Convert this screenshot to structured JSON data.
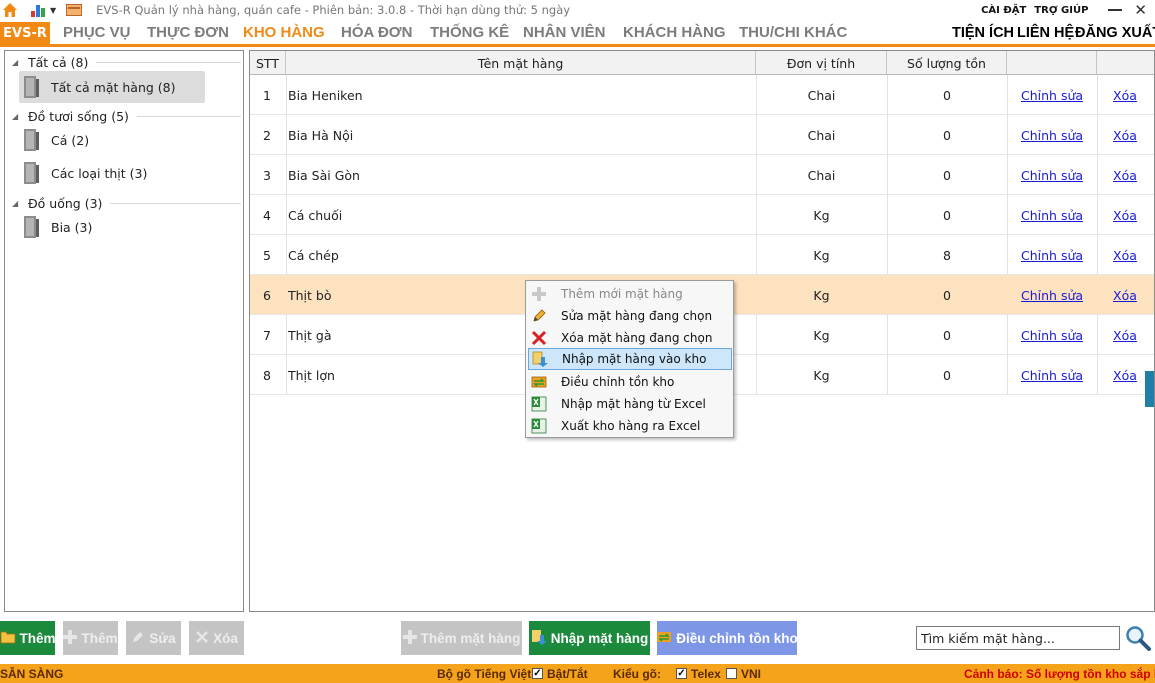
{
  "title_bar": {
    "app_title": "EVS-R Quản lý nhà hàng, quán cafe - Phiên bản: 3.0.8 - Thời hạn dùng thử: 5 ngày",
    "settings": "CÀI ĐẶT",
    "help": "TRỢ GIÚP",
    "close": "✕"
  },
  "menu": {
    "logo": "EVS-R",
    "items": [
      "PHỤC VỤ",
      "THỰC ĐƠN",
      "KHO HÀNG",
      "HÓA ĐƠN",
      "THỐNG KÊ",
      "NHÂN VIÊN",
      "KHÁCH HÀNG",
      "THU/CHI KHÁC"
    ],
    "active": "KHO HÀNG",
    "right": [
      "TIỆN ÍCH",
      "LIÊN HỆ",
      "ĐĂNG XUẤT"
    ]
  },
  "tree": {
    "groups": [
      {
        "label": "Tất cả (8)",
        "items": [
          "Tất cả mặt hàng (8)"
        ]
      },
      {
        "label": "Đồ tươi sống (5)",
        "items": [
          "Cá (2)",
          "Các loại thịt (3)"
        ]
      },
      {
        "label": "Đồ uống (3)",
        "items": [
          "Bia (3)"
        ]
      }
    ],
    "selected": "Tất cả mặt hàng (8)"
  },
  "grid": {
    "columns": [
      "STT",
      "Tên mặt hàng",
      "Đơn vị tính",
      "Số lượng tồn",
      "",
      ""
    ],
    "rows": [
      {
        "stt": "1",
        "name": "Bia Heniken",
        "unit": "Chai",
        "qty": "0",
        "edit": "Chỉnh sửa",
        "delete": "Xóa"
      },
      {
        "stt": "2",
        "name": "Bia Hà Nội",
        "unit": "Chai",
        "qty": "0",
        "edit": "Chỉnh sửa",
        "delete": "Xóa"
      },
      {
        "stt": "3",
        "name": "Bia Sài Gòn",
        "unit": "Chai",
        "qty": "0",
        "edit": "Chỉnh sửa",
        "delete": "Xóa"
      },
      {
        "stt": "4",
        "name": "Cá chuối",
        "unit": "Kg",
        "qty": "0",
        "edit": "Chỉnh sửa",
        "delete": "Xóa"
      },
      {
        "stt": "5",
        "name": "Cá chép",
        "unit": "Kg",
        "qty": "8",
        "edit": "Chỉnh sửa",
        "delete": "Xóa"
      },
      {
        "stt": "6",
        "name": "Thịt bò",
        "unit": "Kg",
        "qty": "0",
        "edit": "Chỉnh sửa",
        "delete": "Xóa"
      },
      {
        "stt": "7",
        "name": "Thịt gà",
        "unit": "Kg",
        "qty": "0",
        "edit": "Chỉnh sửa",
        "delete": "Xóa"
      },
      {
        "stt": "8",
        "name": "Thịt lợn",
        "unit": "Kg",
        "qty": "0",
        "edit": "Chỉnh sửa",
        "delete": "Xóa"
      }
    ],
    "highlighted_row": "6"
  },
  "context_menu": {
    "items": [
      {
        "label": "Thêm mới mặt hàng",
        "icon": "plus-icon",
        "disabled": true
      },
      {
        "label": "Sửa mặt hàng đang chọn",
        "icon": "pencil-icon"
      },
      {
        "label": "Xóa mặt hàng đang chọn",
        "icon": "red-x-icon"
      },
      {
        "label": "Nhập mặt hàng vào kho",
        "icon": "import-arrow-icon",
        "hovered": true
      },
      {
        "label": "Điều chỉnh tồn kho",
        "icon": "refresh-icon"
      },
      {
        "label": "Nhập mặt hàng từ Excel",
        "icon": "excel-icon"
      },
      {
        "label": "Xuất kho hàng ra Excel",
        "icon": "excel-icon"
      }
    ]
  },
  "toolbar": {
    "add_group": "Thêm",
    "add_group_disabled": "Thêm",
    "edit_group": "Sửa",
    "delete_group": "Xóa",
    "add_item": "Thêm mặt hàng",
    "import_item": "Nhập mặt hàng",
    "adjust_stock": "Điều chỉnh tồn kho",
    "search_placeholder": "Tìm kiếm mặt hàng..."
  },
  "status_bar": {
    "ready": "SẴN SÀNG",
    "ime_label": "Bộ gõ Tiếng Việt",
    "toggle_label": "Bật/Tắt",
    "typing_label": "Kiểu gõ:",
    "telex": "Telex",
    "vni": "VNI",
    "warning": "Cảnh báo: Số lượng tồn kho sắp hết"
  },
  "colors": {
    "accent": "#f08a14",
    "status_bar": "#f5a31a",
    "highlight_row": "#fde2bf",
    "green_button": "#1c8a3c",
    "blue_button": "#7d97e6",
    "link": "#1a1ad6"
  }
}
